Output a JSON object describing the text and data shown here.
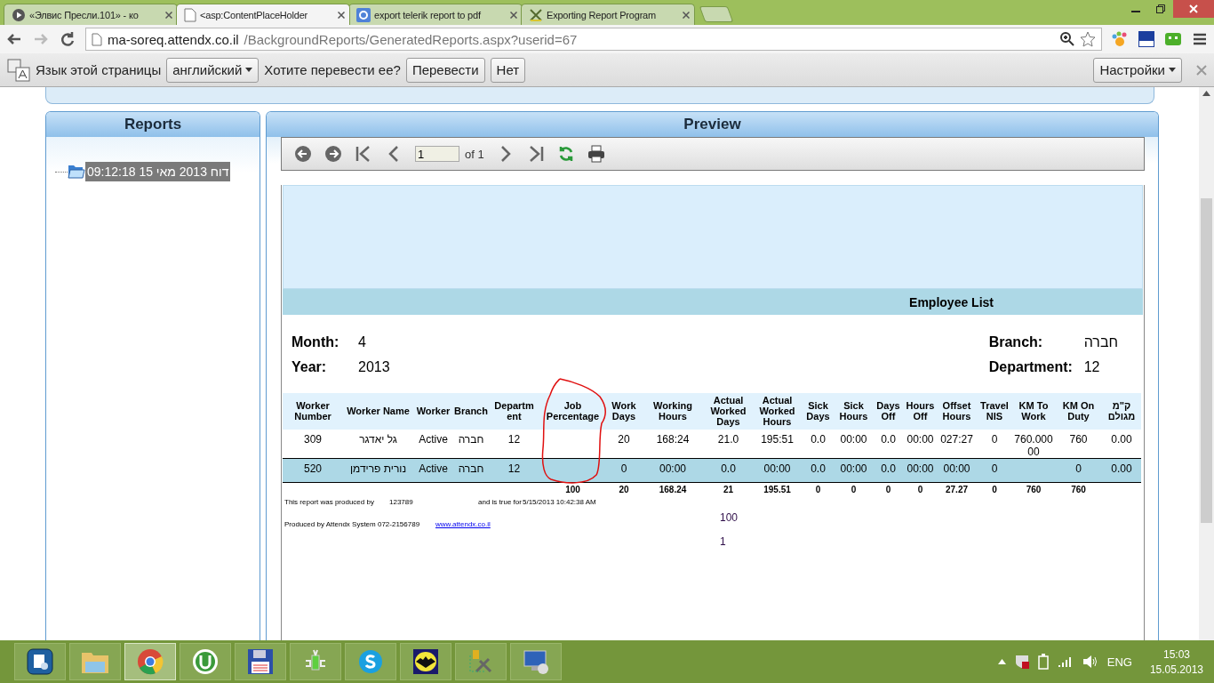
{
  "browser": {
    "tabs": [
      {
        "kind": "video",
        "title": "«Элвис Пресли.101» - ко",
        "selected": false
      },
      {
        "kind": "page",
        "title": "<asp:ContentPlaceHolder",
        "selected": true
      },
      {
        "kind": "google",
        "title": "export telerik report to pdf",
        "selected": false
      },
      {
        "kind": "tool",
        "title": "Exporting Report Program",
        "selected": false
      }
    ],
    "address": {
      "host": "ma-soreq.attendx.co.il",
      "path": "/BackgroundReports/GeneratedReports.aspx?userid=67"
    }
  },
  "translate_bar": {
    "label": "Язык этой страницы",
    "language": "английский",
    "question": "Хотите перевести ее?",
    "buttons": [
      "Перевести",
      "Нет"
    ],
    "settings": "Настройки"
  },
  "reports_panel": {
    "title": "Reports",
    "items": [
      {
        "label": "דוח 2013 מאי 15 09:12:18",
        "selected": true
      }
    ]
  },
  "preview": {
    "title": "Preview",
    "page": "1",
    "page_count": "of 1",
    "report": {
      "title": "Employee List",
      "left_fields": [
        {
          "label": "Month:",
          "value": "4"
        },
        {
          "label": "Year:",
          "value": "2013"
        }
      ],
      "right_fields": [
        {
          "label": "Branch:",
          "value": "חברה"
        },
        {
          "label": "Department:",
          "value": "12"
        }
      ],
      "columns": [
        "Worker Number",
        "Worker Name",
        "Worker",
        "Branch",
        "Departm ent",
        "Job Percentage",
        "Work Days",
        "Working Hours",
        "Actual Worked Days",
        "Actual Worked Hours",
        "Sick Days",
        "Sick Hours",
        "Days Off",
        "Hours Off",
        "Offset Hours",
        "Travel NIS",
        "KM To Work",
        "KM On Duty",
        "ק\"מ מגולם"
      ],
      "rows": [
        {
          "highlighted": false,
          "cells": [
            "309",
            "גל יאדגר",
            "Active",
            "חברה",
            "12",
            null,
            "20",
            "168:24",
            "21.0",
            "195:51",
            "0.0",
            "00:00",
            "0.0",
            "00:00",
            "027:27",
            "0",
            "760.00000",
            "760",
            "0.00"
          ]
        },
        {
          "highlighted": true,
          "cells": [
            "520",
            "נורית פרידמן",
            "Active",
            "חברה",
            "12",
            null,
            "0",
            "00:00",
            "0.0",
            "00:00",
            "0.0",
            "00:00",
            "0.0",
            "00:00",
            "00:00",
            "0",
            null,
            "0",
            "0.00"
          ]
        }
      ],
      "totals": [
        {
          "kind": "blank"
        },
        {
          "kind": "blank"
        },
        {
          "kind": "blank"
        },
        {
          "kind": "blank"
        },
        {
          "kind": "blank"
        },
        {
          "kind": "value",
          "text": "100"
        },
        {
          "kind": "value",
          "text": "20"
        },
        {
          "kind": "value",
          "text": "168.24"
        },
        {
          "kind": "value",
          "text": "21"
        },
        {
          "kind": "value",
          "text": "195.51"
        },
        {
          "kind": "value",
          "text": "0"
        },
        {
          "kind": "value",
          "text": "0"
        },
        {
          "kind": "value",
          "text": "0"
        },
        {
          "kind": "value",
          "text": "0"
        },
        {
          "kind": "value",
          "text": "27.27"
        },
        {
          "kind": "value",
          "text": "0"
        },
        {
          "kind": "value",
          "text": "760"
        },
        {
          "kind": "value",
          "text": "760"
        },
        {
          "kind": "blank"
        }
      ],
      "footer": {
        "produced_by_label": "This report was produced by",
        "produced_by": "123789",
        "true_for_label": "and is true for",
        "true_for": "5/15/2013 10:42:38 AM",
        "sum": "100",
        "system": "Produced by Attendx System 072-2156789",
        "link": "www.attendx.co.il",
        "page_number": "1"
      }
    }
  },
  "taskbar": {
    "apps": [
      {
        "kind": "server",
        "selected": false
      },
      {
        "kind": "folder",
        "selected": false
      },
      {
        "kind": "chrome",
        "selected": true
      },
      {
        "kind": "torrent",
        "selected": false
      },
      {
        "kind": "floppy",
        "selected": false
      },
      {
        "kind": "phone",
        "selected": false
      },
      {
        "kind": "skype",
        "selected": false
      },
      {
        "kind": "bat",
        "selected": false
      },
      {
        "kind": "tools",
        "selected": false
      },
      {
        "kind": "remote",
        "selected": false
      }
    ],
    "language": "ENG",
    "time": "15:03",
    "date": "15.05.2013"
  }
}
